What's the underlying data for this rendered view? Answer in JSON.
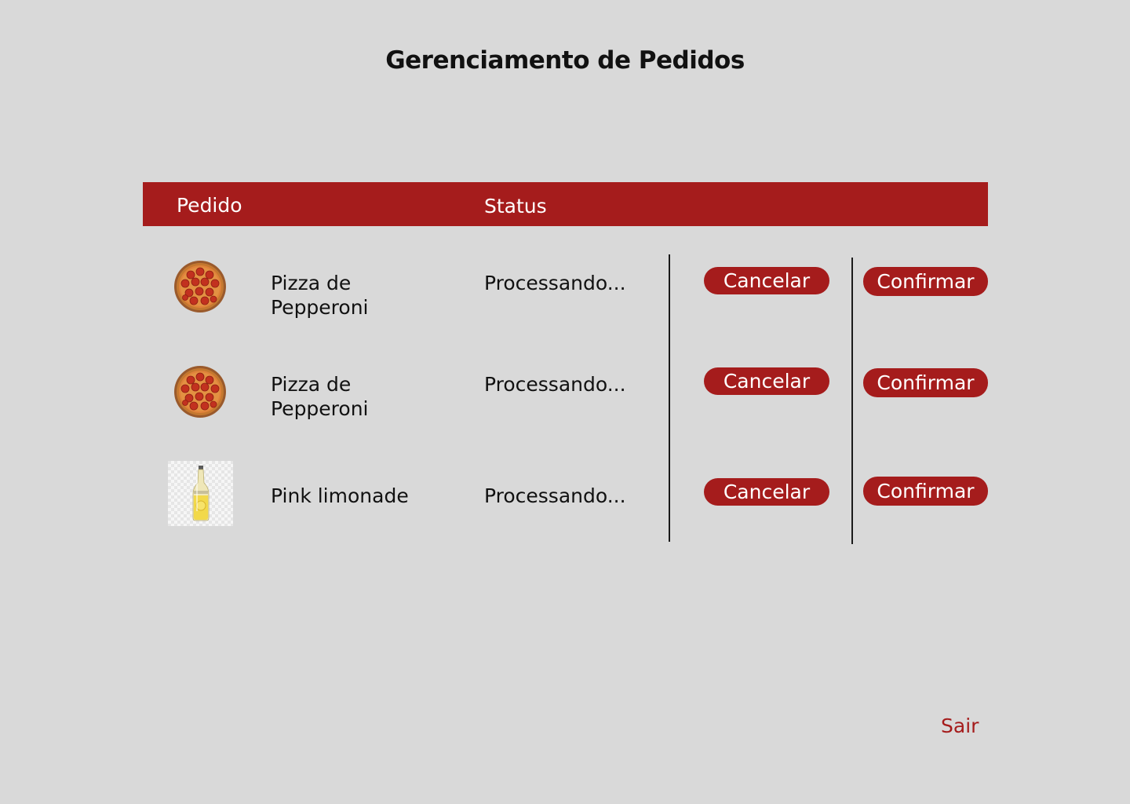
{
  "page": {
    "title": "Gerenciamento de Pedidos"
  },
  "table": {
    "headers": {
      "order": "Pedido",
      "status": "Status"
    },
    "rows": [
      {
        "image": "pepperoni-pizza",
        "name": "Pizza de Pepperoni",
        "status": "Processando...",
        "cancel_label": "Cancelar",
        "confirm_label": "Confirmar"
      },
      {
        "image": "pepperoni-pizza",
        "name": "Pizza de Pepperoni",
        "status": "Processando...",
        "cancel_label": "Cancelar",
        "confirm_label": "Confirmar"
      },
      {
        "image": "lemonade-bottle",
        "name": "Pink limonade",
        "status": "Processando...",
        "cancel_label": "Cancelar",
        "confirm_label": "Confirmar"
      }
    ]
  },
  "footer": {
    "logout_label": "Sair"
  },
  "colors": {
    "accent": "#a51c1c",
    "background": "#d9d9d9",
    "text": "#111111"
  }
}
